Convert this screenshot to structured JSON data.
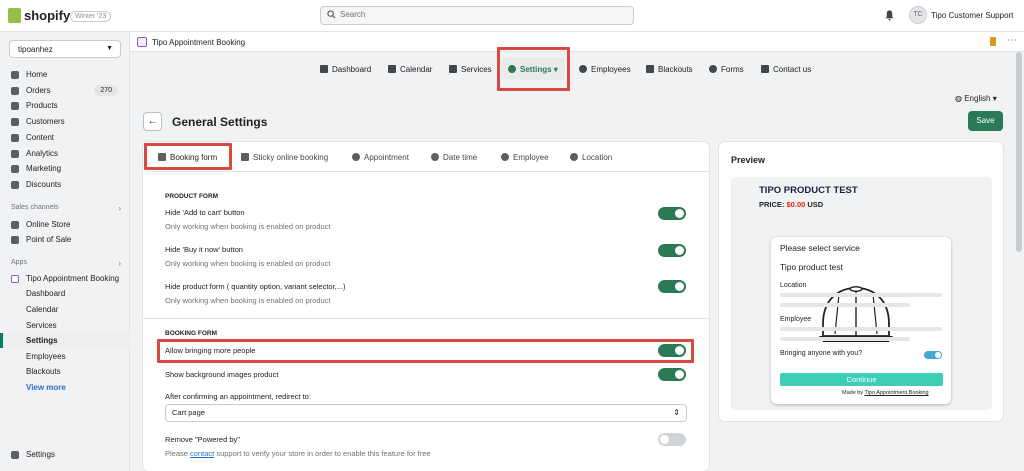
{
  "topbar": {
    "brand": "shopify",
    "badge": "Winter '23",
    "search_placeholder": "Search",
    "avatar_initials": "TC",
    "store_owner": "Tipo Customer Support"
  },
  "sidebar": {
    "store": "tipoanhez",
    "items": [
      {
        "label": "Home"
      },
      {
        "label": "Orders",
        "count": "270"
      },
      {
        "label": "Products"
      },
      {
        "label": "Customers"
      },
      {
        "label": "Content"
      },
      {
        "label": "Analytics"
      },
      {
        "label": "Marketing"
      },
      {
        "label": "Discounts"
      }
    ],
    "sales_channels_label": "Sales channels",
    "sales_channels": [
      "Online Store",
      "Point of Sale"
    ],
    "apps_label": "Apps",
    "app_name": "Tipo Appointment Booking",
    "app_subitems": [
      "Dashboard",
      "Calendar",
      "Services",
      "Settings",
      "Employees",
      "Blackouts"
    ],
    "view_more": "View more",
    "settings": "Settings"
  },
  "appbar": {
    "title": "Tipo Appointment Booking"
  },
  "subnav": [
    "Dashboard",
    "Calendar",
    "Services",
    "Settings",
    "Employees",
    "Blackouts",
    "Forms",
    "Contact us"
  ],
  "language": "English",
  "page": {
    "title": "General Settings",
    "save": "Save"
  },
  "tabs": [
    "Booking form",
    "Sticky online booking",
    "Appointment",
    "Date time",
    "Employee",
    "Location"
  ],
  "product_form": {
    "heading": "PRODUCT FORM",
    "rows": [
      {
        "label": "Hide 'Add to cart' button",
        "help": "Only working when booking is enabled on product",
        "on": true
      },
      {
        "label": "Hide 'Buy it now' button",
        "help": "Only working when booking is enabled on product",
        "on": true
      },
      {
        "label": "Hide product form ( quantity option, variant selector,...)",
        "help": "Only working when booking is enabled on product",
        "on": true
      }
    ]
  },
  "booking_form": {
    "heading": "BOOKING FORM",
    "allow_more": "Allow bringing more people",
    "show_bg": "Show background images product",
    "redirect_label": "After confirming an appointment, redirect to:",
    "redirect_value": "Cart page",
    "powered_label": "Remove \"Powered by\"",
    "powered_help_pre": "Please",
    "powered_help_link": "contact",
    "powered_help_post": "support to verify your store in order to enable this feature for free"
  },
  "preview": {
    "title": "Preview",
    "product": "TIPO PRODUCT TEST",
    "price_label": "PRICE:",
    "price_value": "$0.00",
    "currency": "USD",
    "widget": {
      "heading": "Please select service",
      "product": "Tipo product test",
      "location": "Location",
      "employee": "Employee",
      "bringing": "Bringing anyone with you?",
      "continue": "Continue",
      "made_by": "Made by",
      "made_by_link": "Tipo Appointment Booking"
    }
  }
}
